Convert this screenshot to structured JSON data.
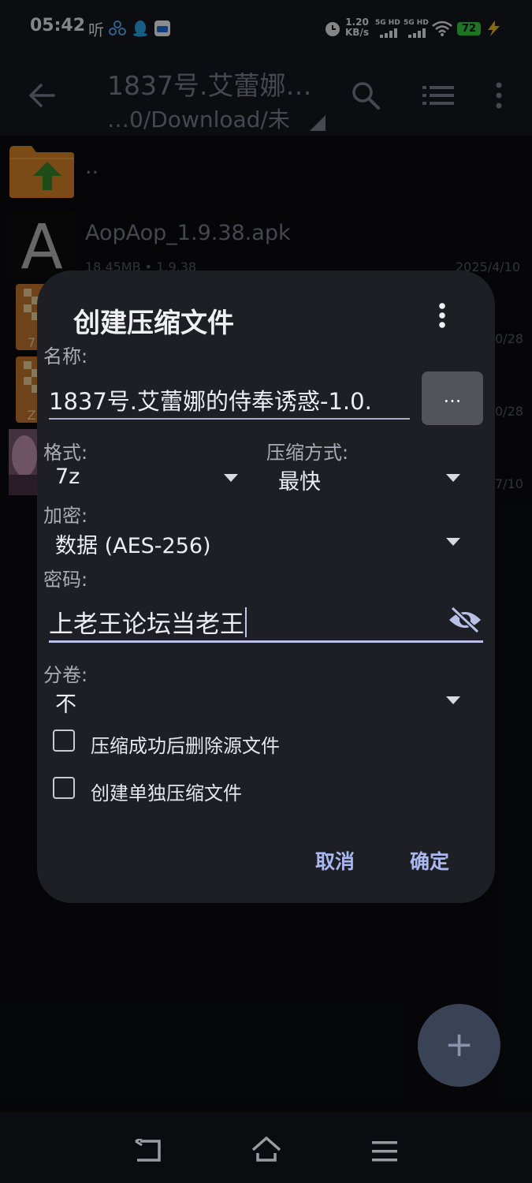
{
  "status_bar": {
    "time": "05:42",
    "ting_label": "听",
    "speed_value": "1.20",
    "speed_unit": "KB/s",
    "sim1": "5G HD",
    "sim2": "5G HD",
    "battery": "72"
  },
  "app_bar": {
    "title": "1837号.艾蕾娜…",
    "subtitle": "…0/Download/未"
  },
  "files": [
    {
      "name": "..",
      "meta": "",
      "date": ""
    },
    {
      "name": "AopAop_1.9.38.apk",
      "meta": "18.45MB  • 1.9.38",
      "date": "2025/4/10"
    },
    {
      "name": "",
      "meta": "",
      "date": "0/28",
      "icon_letter": "7"
    },
    {
      "name": "",
      "meta": "",
      "date": "0/28",
      "icon_letter": "Z"
    },
    {
      "name": "",
      "meta": "",
      "date": "7/10"
    }
  ],
  "dialog": {
    "title": "创建压缩文件",
    "name_label": "名称:",
    "name_value": "1837号.艾蕾娜的侍奉诱惑-1.0.",
    "browse_label": "...",
    "format_label": "格式:",
    "format_value": "7z",
    "method_label": "压缩方式:",
    "method_value": "最快",
    "encryption_label": "加密:",
    "encryption_value": "数据 (AES-256)",
    "password_label": "密码:",
    "password_value": "上老王论坛当老王",
    "split_label": "分卷:",
    "split_value": "不",
    "delete_source_label": "压缩成功后删除源文件",
    "delete_source_checked": false,
    "separate_archive_label": "创建单独压缩文件",
    "separate_archive_checked": false,
    "cancel_label": "取消",
    "ok_label": "确定"
  },
  "fab": {
    "symbol": "+"
  },
  "colors": {
    "dialog_bg": "#1d1f24",
    "accent_text": "#a9b8f0",
    "folder_orange": "#e0892a",
    "up_arrow_green": "#3a8a2e",
    "battery_green": "#3ad14a"
  }
}
